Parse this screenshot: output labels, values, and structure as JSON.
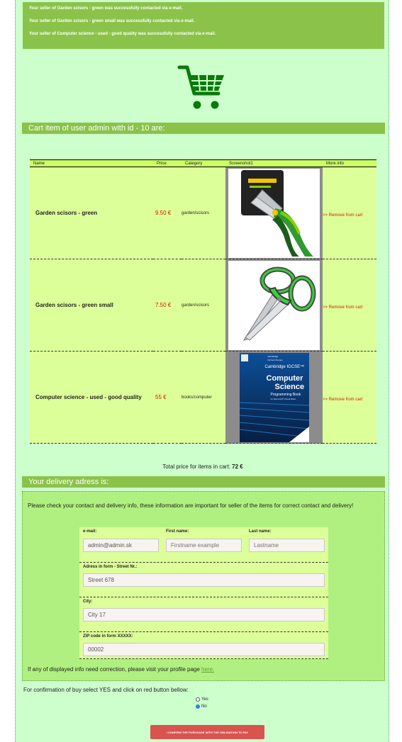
{
  "notices": [
    "Your seller of Garden scisors - green was successfully contacted via e-mail.",
    "Your seller of Garden scisors - green small was successfully contacted via e-mail.",
    "Your seller of Computer science - used - good quality was successfully contacted via e-mail."
  ],
  "cart_icon": "shopping-cart-icon",
  "cart_title": "Cart item of user admin with id - 10 are:",
  "table": {
    "headers": [
      "Name",
      "Price",
      "Category",
      "Screenshot1",
      "More info"
    ],
    "rows": [
      {
        "name": "Garden scisors - green",
        "price": "9.50 €",
        "category": "garden/scisors",
        "screenshot": "pruning-shears-image",
        "action": ">> Remove from cart"
      },
      {
        "name": "Garden scisors - green small",
        "price": "7.50 €",
        "category": "garden/scisors",
        "screenshot": "kitchen-scissors-image",
        "action": ">> Remove from cart"
      },
      {
        "name": "Computer science - used - good quality",
        "price": "55 €",
        "category": "books/computer",
        "screenshot": "book-cover-image",
        "action": ">> Remove from cart"
      }
    ]
  },
  "book_cover": {
    "publisher": "Cambridge",
    "subtitle": "Cambridge IGCSE™",
    "author": "Richard Morgan",
    "title_line1": "Computer",
    "title_line2": "Science",
    "book_type": "Programming Book",
    "edition": "for Microsoft® Visual Basic"
  },
  "total": {
    "label": "Total price for items in cart:",
    "value": "72 €"
  },
  "delivery_title": "Your delivery adress is:",
  "delivery_text": "Please check your contact and delivery info, these information are important for seller of the items for correct contact and delivery!",
  "form": {
    "email_label": "e-mail:",
    "email_value": "admin@admin.sk",
    "firstname_label": "First name:",
    "firstname_placeholder": "Firstname example",
    "lastname_label": "Last name:",
    "lastname_placeholder": "Lastname",
    "street_label": "Adress in form - Street Nr.:",
    "street_value": "Street 678",
    "city_label": "City:",
    "city_value": "City 17",
    "zip_label": "ZIP code in form XXXXX:",
    "zip_value": "00002"
  },
  "profile_line": {
    "text": "If any of displayed info need correction, please visit your profile page",
    "link": "here."
  },
  "confirmation": {
    "text": "For confirmation of buy select YES and click on red button bellow:",
    "yes_label": "Yes",
    "no_label": "No",
    "selected": "No",
    "button": "I CONFIRM THE PURCHASE WITH THE OBLIGATION TO PAY"
  },
  "colors": {
    "accent": "#8bc34a",
    "page_bg": "#ccffcc",
    "table_bg": "#ddff99",
    "price": "#cc2200",
    "button": "#d9534f",
    "cart_icon": "#0a7a0a"
  }
}
